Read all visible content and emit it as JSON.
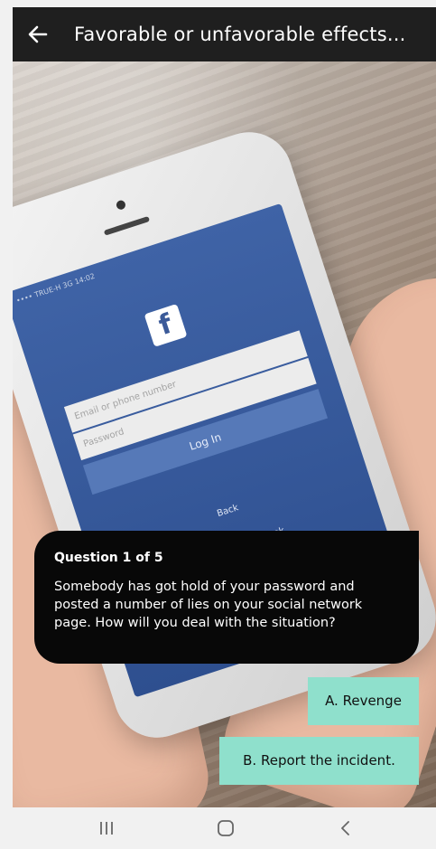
{
  "header": {
    "title": "Favorable or unfavorable effects...",
    "back_icon": "arrow-left-icon"
  },
  "phone_screen": {
    "status": "•••• TRUE-H 3G   14:02",
    "logo": "f",
    "email_placeholder": "Email or phone number",
    "password_placeholder": "Password",
    "login_label": "Log In",
    "back_label": "Back",
    "signup_label": "Sign Up for Facebook"
  },
  "question": {
    "counter": "Question 1 of 5",
    "text": "Somebody has got hold of your password and posted a number of lies on your social network page. How will you deal with the situation?"
  },
  "answers": [
    {
      "label": "A.  Revenge"
    },
    {
      "label": "B.  Report the incident."
    }
  ],
  "navbar": {
    "recents_icon": "recents-icon",
    "home_icon": "home-icon",
    "back_icon": "back-chevron-icon"
  },
  "colors": {
    "topbar": "#1f1f1f",
    "question_bg": "#080808",
    "answer_bg": "#8fe0cc"
  }
}
